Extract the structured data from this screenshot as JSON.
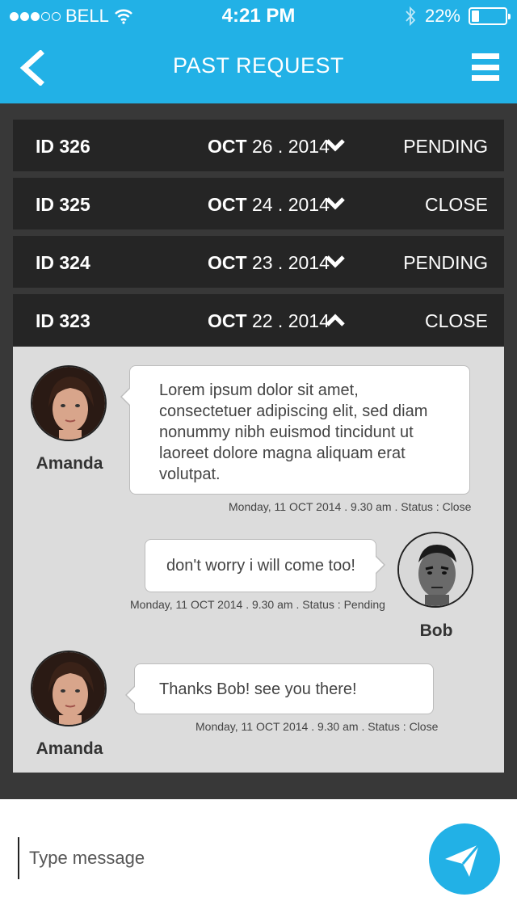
{
  "status_bar": {
    "carrier": "BELL",
    "time": "4:21 PM",
    "battery": "22%",
    "battery_level": 0.22
  },
  "header": {
    "title": "PAST REQUEST",
    "back_icon": "chevron-left-icon",
    "menu_icon": "hamburger-menu-icon"
  },
  "requests": [
    {
      "id": "ID 326",
      "date_month": "OCT",
      "date_rest": " 26 . 2014",
      "status": "PENDING",
      "expanded": false
    },
    {
      "id": "ID 325",
      "date_month": "OCT",
      "date_rest": " 24 . 2014",
      "status": "CLOSE",
      "expanded": false
    },
    {
      "id": "ID 324",
      "date_month": "OCT",
      "date_rest": " 23 . 2014",
      "status": "PENDING",
      "expanded": false
    },
    {
      "id": "ID 323",
      "date_month": "OCT",
      "date_rest": " 22 . 2014",
      "status": "CLOSE",
      "expanded": true
    }
  ],
  "conversation": [
    {
      "sender": "Amanda",
      "side": "left",
      "text": "Lorem ipsum dolor sit amet, consectetuer adipiscing elit, sed diam nonummy nibh euismod tincidunt ut laoreet dolore magna aliquam erat volutpat.",
      "meta": "Monday, 11 OCT 2014 . 9.30 am . Status : Close"
    },
    {
      "sender": "Bob",
      "side": "right",
      "text": "don't worry i will come too!",
      "meta": "Monday, 11 OCT 2014 . 9.30 am . Status : Pending"
    },
    {
      "sender": "Amanda",
      "side": "left",
      "text": "Thanks Bob! see you there!",
      "meta": "Monday, 11 OCT 2014 . 9.30 am . Status : Close"
    }
  ],
  "composer": {
    "placeholder": "Type message",
    "send_icon": "paper-plane-icon"
  },
  "colors": {
    "accent": "#22b1e6",
    "row_bg": "#252525",
    "panel_bg": "#dcdcdc",
    "page_bg": "#383838"
  }
}
